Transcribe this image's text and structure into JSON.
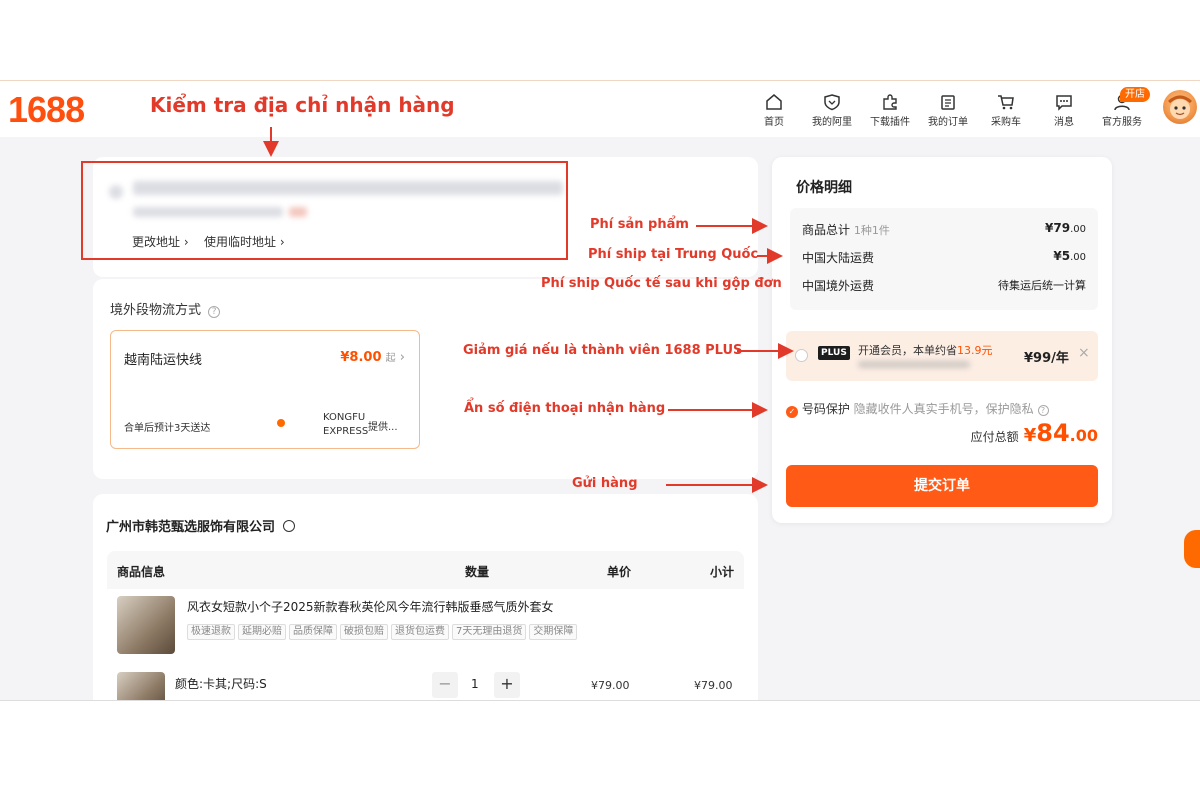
{
  "header": {
    "logo": "1688",
    "nav": [
      {
        "label": "首页",
        "icon": "home-icon"
      },
      {
        "label": "我的阿里",
        "icon": "heart-shield-icon"
      },
      {
        "label": "下载插件",
        "icon": "puzzle-icon"
      },
      {
        "label": "我的订单",
        "icon": "clipboard-icon"
      },
      {
        "label": "采购车",
        "icon": "cart-icon"
      },
      {
        "label": "消息",
        "icon": "chat-icon"
      },
      {
        "label": "官方服务",
        "icon": "user-icon"
      }
    ],
    "open_store_badge": "开店"
  },
  "address": {
    "change_link": "更改地址",
    "temp_link": "使用临时地址"
  },
  "shipping": {
    "title": "境外段物流方式",
    "option": {
      "name": "越南陆运快线",
      "price": "¥8.00",
      "price_suffix": "起",
      "eta": "合单后预计3天送达",
      "carrier_line1": "KONGFU",
      "carrier_line2": "EXPRESS",
      "provider": "提供..."
    }
  },
  "shop": {
    "name": "广州市韩范甄选服饰有限公司",
    "columns": [
      "商品信息",
      "数量",
      "单价",
      "小计"
    ],
    "product": {
      "title": "风衣女短款小个子2025新款春秋英伦风今年流行韩版垂感气质外套女",
      "tags": [
        "极速退款",
        "延期必赔",
        "品质保障",
        "破损包赔",
        "退货包运费",
        "7天无理由退货",
        "交期保障"
      ]
    },
    "sku": {
      "variant": "颜色:卡其;尺码:S",
      "qty": "1",
      "unit_price": "¥79.00",
      "subtotal": "¥79.00"
    }
  },
  "price": {
    "title": "价格明细",
    "rows": [
      {
        "label": "商品总计",
        "sub": "1种1件",
        "value_main": "¥79",
        "value_dec": ".00"
      },
      {
        "label": "中国大陆运费",
        "sub": "",
        "value_main": "¥5",
        "value_dec": ".00"
      },
      {
        "label": "中国境外运费",
        "sub": "",
        "value_main": "待集运后统一计算",
        "value_dec": ""
      }
    ],
    "plus": {
      "badge": "PLUS",
      "text": "开通会员，本单约省",
      "save": "13.9元",
      "price": "¥99/年"
    },
    "privacy": {
      "label": "号码保护",
      "desc": "隐藏收件人真实手机号，保护隐私"
    },
    "total_label": "应付总额",
    "total_symbol": "¥",
    "total_main": "84",
    "total_dec": ".00",
    "submit": "提交订单"
  },
  "annotations": {
    "title": "Kiểm tra địa chỉ nhận hàng",
    "product_fee": "Phí sản phẩm",
    "china_ship": "Phí ship tại Trung Quốc",
    "intl_ship": "Phí ship Quốc tế sau khi gộp đơn",
    "plus_discount": "Giảm giá nếu là thành viên 1688 PLUS",
    "hide_phone": "Ẩn số điện thoại nhận hàng",
    "send": "Gửi hàng"
  },
  "colors": {
    "accent": "#ff5000",
    "annotation": "#e13a2a"
  }
}
